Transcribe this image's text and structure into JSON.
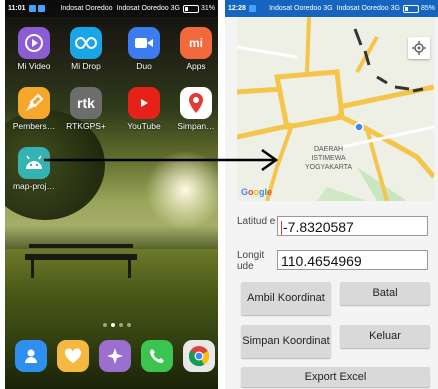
{
  "left_phone": {
    "statusbar": {
      "time": "11:01",
      "signal_text": "Indosat Ooredoo",
      "signal_text2": "Indosat Ooredoo 3G",
      "battery": "31%"
    },
    "apps": [
      {
        "label": "Mi Video",
        "icon": "play-icon",
        "color": "#8e5bd6"
      },
      {
        "label": "Mi Drop",
        "icon": "infinity-icon",
        "color": "#18a6e8"
      },
      {
        "label": "Duo",
        "icon": "video-camera-icon",
        "color": "#3d7cf0"
      },
      {
        "label": "Apps",
        "icon": "mi-logo-icon",
        "color": "#f26a3c"
      },
      {
        "label": "Pembers…",
        "icon": "broom-icon",
        "color": "#f7a62c"
      },
      {
        "label": "RTKGPS+",
        "icon": "rtk-icon",
        "color": "#6d6d6d"
      },
      {
        "label": "YouTube",
        "icon": "youtube-icon",
        "color": "#e62117"
      },
      {
        "label": "Simpan…",
        "icon": "map-pin-icon",
        "color": "#ffffff"
      },
      {
        "label": "map-proj…",
        "icon": "android-icon",
        "color": "#35b3b3"
      }
    ],
    "dock": [
      {
        "icon": "contacts-icon",
        "color": "#2f8ff0"
      },
      {
        "icon": "heart-icon",
        "color": "#f5b942"
      },
      {
        "icon": "airplane-icon",
        "color": "#9a6fd0"
      },
      {
        "icon": "phone-icon",
        "color": "#3cc450"
      },
      {
        "icon": "chrome-icon",
        "color": "#e8e8e8"
      }
    ]
  },
  "right_phone": {
    "statusbar": {
      "time": "12:28",
      "signal_text": "Indosat Ooredoo 3G",
      "signal_text2": "Indosat Ooredoo 3G",
      "battery": "85%"
    },
    "map": {
      "label1": "DAERAH",
      "label2": "ISTIMEWA",
      "label3": "YOGYAKARTA",
      "attribution": "Google"
    },
    "latitude": {
      "label": "Latitud e",
      "value": "-7.8320587"
    },
    "longitude": {
      "label": "Longit ude",
      "value": "110.4654969"
    },
    "buttons": {
      "ambil": "Ambil Koordinat",
      "batal": "Batal",
      "simpan": "Simpan Koordinat",
      "keluar": "Keluar",
      "export": "Export Excel"
    }
  }
}
